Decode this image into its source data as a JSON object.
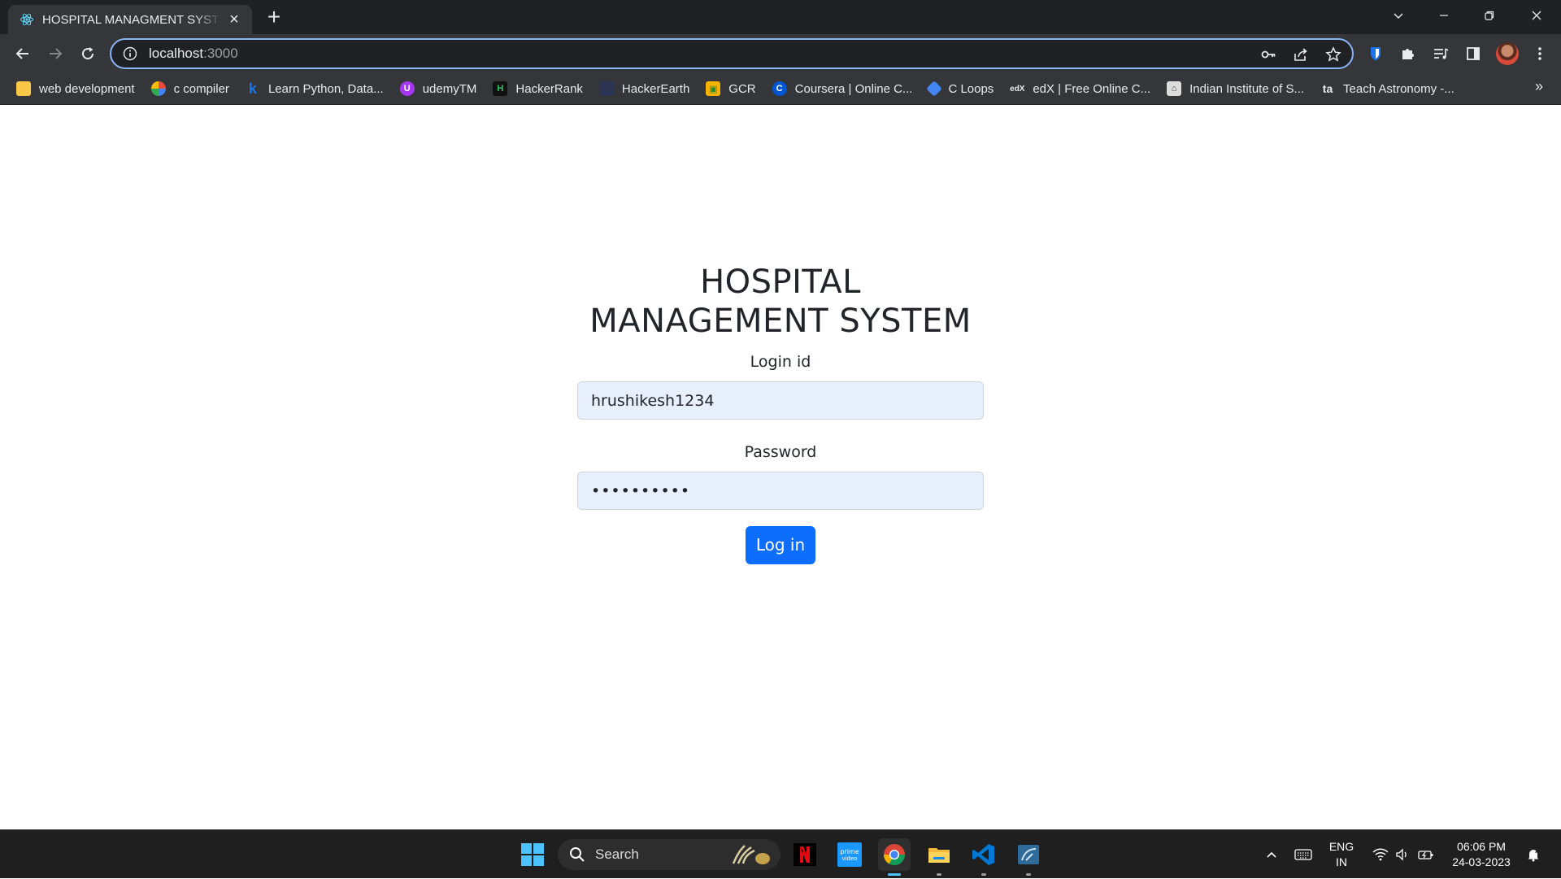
{
  "browser": {
    "tab_title": "HOSPITAL MANAGMENT SYSTEM",
    "url_host": "localhost",
    "url_port": ":3000",
    "bookmarks": [
      {
        "label": "web development",
        "icon": "folder-icon",
        "color": "#f9c846"
      },
      {
        "label": "c compiler",
        "icon": "compiler-icon",
        "color": "#e94b3c"
      },
      {
        "label": "Learn Python, Data...",
        "icon": "k-icon",
        "color": "#1a73e8"
      },
      {
        "label": "udemyTM",
        "icon": "udemy-icon",
        "color": "#a435f0"
      },
      {
        "label": "HackerRank",
        "icon": "hackerrank-icon",
        "color": "#111111"
      },
      {
        "label": "HackerEarth",
        "icon": "hackerearth-icon",
        "color": "#2c3454"
      },
      {
        "label": "GCR",
        "icon": "classroom-icon",
        "color": "#f4b400"
      },
      {
        "label": "Coursera | Online C...",
        "icon": "coursera-icon",
        "color": "#0056d2"
      },
      {
        "label": "C Loops",
        "icon": "cloops-icon",
        "color": "#4285f4"
      },
      {
        "label": "edX | Free Online C...",
        "icon": "edx-icon",
        "color": "#35363a"
      },
      {
        "label": "Indian Institute of S...",
        "icon": "iisc-icon",
        "color": "#dddddd"
      },
      {
        "label": "Teach Astronomy -...",
        "icon": "teach-astronomy-icon",
        "color": "#35363a"
      }
    ]
  },
  "login": {
    "title": "HOSPITAL MANAGEMENT SYSTEM",
    "login_label": "Login id",
    "login_value": "hrushikesh1234",
    "password_label": "Password",
    "password_value": "••••••••••",
    "button_label": "Log in"
  },
  "taskbar": {
    "search_label": "Search",
    "lang_line1": "ENG",
    "lang_line2": "IN",
    "time": "06:06 PM",
    "date": "24-03-2023"
  },
  "colors": {
    "primary": "#0d6efd",
    "autofill_bg": "#e8f0fe",
    "chrome_dark": "#202124",
    "chrome_toolbar": "#35363a",
    "omnibox_focus": "#8ab4f8"
  }
}
